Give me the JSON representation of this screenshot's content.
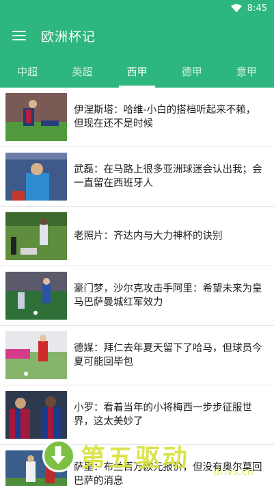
{
  "status_bar": {
    "time": "8:45",
    "wifi_icon": "wifi-icon"
  },
  "app_bar": {
    "title": "欧洲杯记",
    "menu_icon": "menu-icon"
  },
  "tabs": [
    {
      "label": "中超"
    },
    {
      "label": "英超"
    },
    {
      "label": "西甲",
      "active": true
    },
    {
      "label": "德甲"
    },
    {
      "label": "意甲"
    }
  ],
  "articles": [
    {
      "title": "伊涅斯塔：哈维-小白的搭档听起来不赖，但现在还不是时候"
    },
    {
      "title": "武磊：在马路上很多亚洲球迷会认出我；会一直留在西班牙人"
    },
    {
      "title": "老照片：齐达内与大力神杯的诀别"
    },
    {
      "title": "豪门梦，沙尔克攻击手阿里：希望未来为皇马巴萨曼城红军效力"
    },
    {
      "title": "德媒：拜仁去年夏天留下了哈马，但球员今夏可能回毕包"
    },
    {
      "title": "小罗：看着当年的小将梅西一步步征服世界，这太美妙了"
    },
    {
      "title": "萨里：布兰百万欧元报价，但没有奥尔莫回巴萨的消息"
    }
  ],
  "watermark": {
    "text": "第五驱动",
    "url": "drivs.cn"
  },
  "colors": {
    "brand": "#2db67d"
  }
}
